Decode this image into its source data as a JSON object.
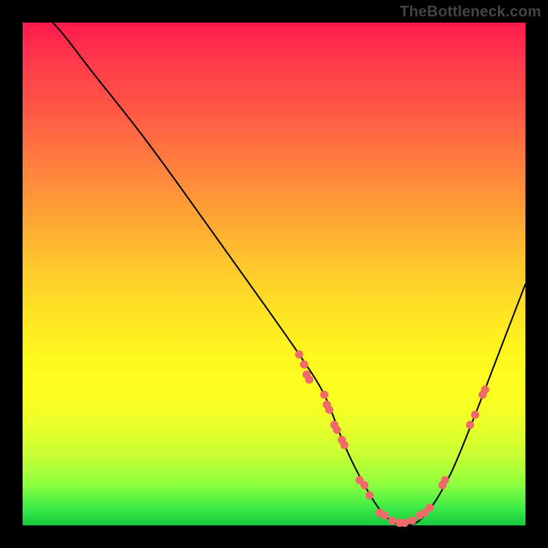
{
  "watermark": "TheBottleneck.com",
  "colors": {
    "background": "#000000",
    "curve": "#000000",
    "dot": "#f06a6a",
    "gradient_top": "#ff1a4d",
    "gradient_mid": "#fff81e",
    "gradient_bottom": "#17c93c"
  },
  "chart_data": {
    "type": "line",
    "title": "",
    "xlabel": "",
    "ylabel": "",
    "xlim": [
      0,
      100
    ],
    "ylim": [
      0,
      100
    ],
    "x": [
      0,
      6,
      14,
      25,
      38,
      48,
      55,
      60,
      64,
      68,
      72,
      76,
      80,
      85,
      90,
      95,
      100
    ],
    "y_curve": [
      104,
      100,
      90,
      76,
      58,
      44,
      34,
      26,
      16,
      8,
      2,
      0,
      2,
      10,
      22,
      35,
      48
    ],
    "series": [
      {
        "name": "bottleneck-curve",
        "x": [
          0,
          6,
          14,
          25,
          38,
          48,
          55,
          60,
          64,
          68,
          72,
          76,
          80,
          85,
          90,
          95,
          100
        ],
        "y": [
          104,
          100,
          90,
          76,
          58,
          44,
          34,
          26,
          16,
          8,
          2,
          0,
          2,
          10,
          22,
          35,
          48
        ]
      }
    ],
    "dot_clusters": [
      {
        "name": "cluster-left-upper",
        "points": [
          [
            55,
            34
          ],
          [
            56,
            32
          ],
          [
            56.5,
            30
          ],
          [
            57,
            29
          ]
        ]
      },
      {
        "name": "cluster-left-mid",
        "points": [
          [
            60,
            26
          ],
          [
            60.5,
            24
          ],
          [
            61,
            23
          ],
          [
            62,
            20
          ],
          [
            62.5,
            19
          ],
          [
            63.5,
            17
          ],
          [
            64,
            16
          ]
        ]
      },
      {
        "name": "cluster-left-low",
        "points": [
          [
            67,
            9
          ],
          [
            68,
            8
          ],
          [
            69,
            6
          ]
        ]
      },
      {
        "name": "cluster-valley",
        "points": [
          [
            71,
            2.5
          ],
          [
            72,
            2
          ],
          [
            73.5,
            1
          ],
          [
            75,
            0.5
          ],
          [
            76,
            0.5
          ],
          [
            77.5,
            1
          ],
          [
            79,
            2
          ],
          [
            80,
            2.5
          ],
          [
            81,
            3.5
          ]
        ]
      },
      {
        "name": "cluster-right-low",
        "points": [
          [
            83.5,
            8
          ],
          [
            84,
            9
          ]
        ]
      },
      {
        "name": "cluster-right-mid",
        "points": [
          [
            89,
            20
          ],
          [
            90,
            22
          ],
          [
            91.5,
            26
          ],
          [
            92,
            27
          ]
        ]
      }
    ]
  }
}
